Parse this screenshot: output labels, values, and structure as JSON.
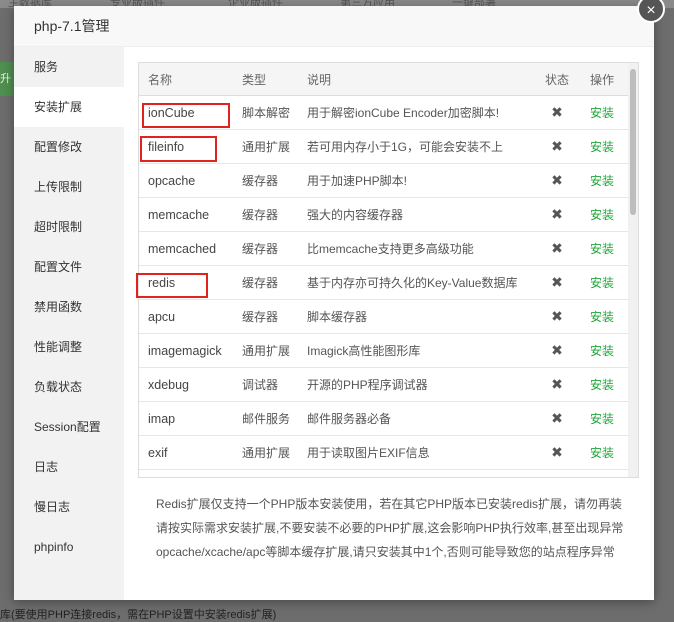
{
  "background": {
    "top_tabs": [
      "主数据库",
      "专业版插件",
      "企业版插件",
      "第三方应用",
      "一键部署"
    ],
    "left_strip_text": "升级",
    "bottom_text": "库(要使用PHP连接redis，需在PHP设置中安装redis扩展)"
  },
  "modal": {
    "title": "php-7.1管理",
    "close_symbol": "×"
  },
  "sidebar": {
    "items": [
      {
        "label": "服务"
      },
      {
        "label": "安装扩展"
      },
      {
        "label": "配置修改"
      },
      {
        "label": "上传限制"
      },
      {
        "label": "超时限制"
      },
      {
        "label": "配置文件"
      },
      {
        "label": "禁用函数"
      },
      {
        "label": "性能调整"
      },
      {
        "label": "负载状态"
      },
      {
        "label": "Session配置"
      },
      {
        "label": "日志"
      },
      {
        "label": "慢日志"
      },
      {
        "label": "phpinfo"
      }
    ],
    "active_index": 1
  },
  "table": {
    "headers": {
      "name": "名称",
      "type": "类型",
      "desc": "说明",
      "status": "状态",
      "op": "操作"
    },
    "rows": [
      {
        "name": "ionCube",
        "type": "脚本解密",
        "desc": "用于解密ionCube Encoder加密脚本!",
        "status": "✖",
        "op": "安装"
      },
      {
        "name": "fileinfo",
        "type": "通用扩展",
        "desc": "若可用内存小于1G，可能会安装不上",
        "status": "✖",
        "op": "安装"
      },
      {
        "name": "opcache",
        "type": "缓存器",
        "desc": "用于加速PHP脚本!",
        "status": "✖",
        "op": "安装"
      },
      {
        "name": "memcache",
        "type": "缓存器",
        "desc": "强大的内容缓存器",
        "status": "✖",
        "op": "安装"
      },
      {
        "name": "memcached",
        "type": "缓存器",
        "desc": "比memcache支持更多高级功能",
        "status": "✖",
        "op": "安装"
      },
      {
        "name": "redis",
        "type": "缓存器",
        "desc": "基于内存亦可持久化的Key-Value数据库",
        "status": "✖",
        "op": "安装"
      },
      {
        "name": "apcu",
        "type": "缓存器",
        "desc": "脚本缓存器",
        "status": "✖",
        "op": "安装"
      },
      {
        "name": "imagemagick",
        "type": "通用扩展",
        "desc": "Imagick高性能图形库",
        "status": "✖",
        "op": "安装"
      },
      {
        "name": "xdebug",
        "type": "调试器",
        "desc": "开源的PHP程序调试器",
        "status": "✖",
        "op": "安装"
      },
      {
        "name": "imap",
        "type": "邮件服务",
        "desc": "邮件服务器必备",
        "status": "✖",
        "op": "安装"
      },
      {
        "name": "exif",
        "type": "通用扩展",
        "desc": "用于读取图片EXIF信息",
        "status": "✖",
        "op": "安装"
      },
      {
        "name": "",
        "type": "",
        "desc": "",
        "status": "",
        "op": ""
      }
    ]
  },
  "notes": [
    "Redis扩展仅支持一个PHP版本安装使用，若在其它PHP版本已安装redis扩展，请勿再装",
    "请按实际需求安装扩展,不要安装不必要的PHP扩展,这会影响PHP执行效率,甚至出现异常",
    "opcache/xcache/apc等脚本缓存扩展,请只安装其中1个,否则可能导致您的站点程序异常"
  ],
  "colors": {
    "install_link": "#20a53a",
    "highlight_box": "#e0241b",
    "overlay": "#6d6d6d"
  }
}
